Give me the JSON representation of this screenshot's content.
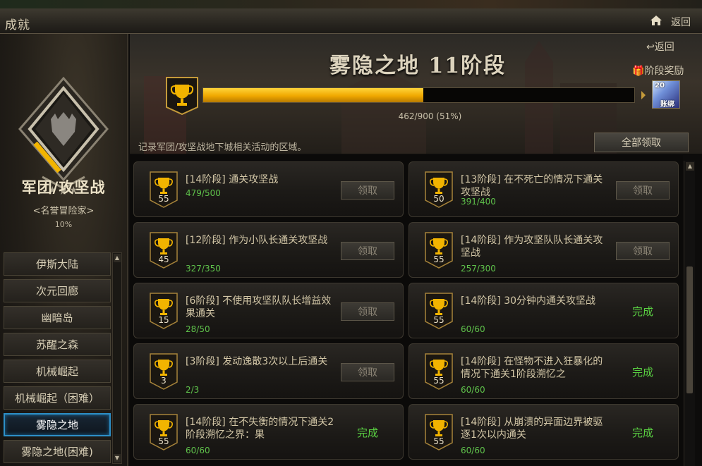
{
  "window": {
    "title": "成就",
    "back_label": "返回",
    "home_icon": "home-icon"
  },
  "category": {
    "title": "军团/攻坚战",
    "subtitle": "<名誉冒险家>",
    "percent": "10%",
    "nav_items": [
      {
        "label": "伊斯大陆",
        "active": false
      },
      {
        "label": "次元回廊",
        "active": false
      },
      {
        "label": "幽暗岛",
        "active": false
      },
      {
        "label": "苏醒之森",
        "active": false
      },
      {
        "label": "机械崛起",
        "active": false
      },
      {
        "label": "机械崛起（困难）",
        "active": false
      },
      {
        "label": "雾隐之地",
        "active": true
      },
      {
        "label": "雾隐之地(困难)",
        "active": false
      }
    ]
  },
  "header": {
    "back_label": "返回",
    "stage_reward_label": "阶段奖励",
    "stage_title": "雾隐之地  11阶段",
    "progress_text": "462/900 (51%)",
    "progress_fraction": 0.51,
    "reward_item_count": "20",
    "reward_item_text": "账绑",
    "description": "记录军团/攻坚战地下城相关活动的区域。",
    "claim_all_label": "全部领取"
  },
  "achievements": [
    {
      "title": "[14阶段] 通关攻坚战",
      "progress": "479/500",
      "badge": "55",
      "status": "claim",
      "status_label": "领取"
    },
    {
      "title": "[13阶段] 在不死亡的情况下通关攻坚战",
      "progress": "391/400",
      "badge": "50",
      "status": "claim",
      "status_label": "领取"
    },
    {
      "title": "[12阶段] 作为小队长通关攻坚战",
      "progress": "327/350",
      "badge": "45",
      "status": "claim",
      "status_label": "领取"
    },
    {
      "title": "[14阶段] 作为攻坚队队长通关攻坚战",
      "progress": "257/300",
      "badge": "55",
      "status": "claim",
      "status_label": "领取"
    },
    {
      "title": "[6阶段] 不使用攻坚队队长增益效果通关",
      "progress": "28/50",
      "badge": "15",
      "status": "claim",
      "status_label": "领取"
    },
    {
      "title": "[14阶段] 30分钟内通关攻坚战",
      "progress": "60/60",
      "badge": "55",
      "status": "done",
      "status_label": "完成"
    },
    {
      "title": "[3阶段] 发动逸散3次以上后通关",
      "progress": "2/3",
      "badge": "3",
      "status": "claim",
      "status_label": "领取"
    },
    {
      "title": "[14阶段] 在怪物不进入狂暴化的情况下通关1阶段溯忆之",
      "progress": "60/60",
      "badge": "55",
      "status": "done",
      "status_label": "完成"
    },
    {
      "title": "[14阶段] 在不失衡的情况下通关2阶段溯忆之界：果",
      "progress": "60/60",
      "badge": "55",
      "status": "done",
      "status_label": "完成"
    },
    {
      "title": "[14阶段] 从崩溃的异面边界被驱逐1次以内通关",
      "progress": "60/60",
      "badge": "55",
      "status": "done",
      "status_label": "完成"
    }
  ],
  "colors": {
    "accent_gold": "#f0a800",
    "progress_green": "#5fc24b",
    "active_nav": "#2d8fc7",
    "done_green": "#5ad042"
  },
  "icons": [
    "home-icon",
    "back-arrow-icon",
    "gift-icon",
    "trophy-icon",
    "achievement-emblem-icon"
  ]
}
